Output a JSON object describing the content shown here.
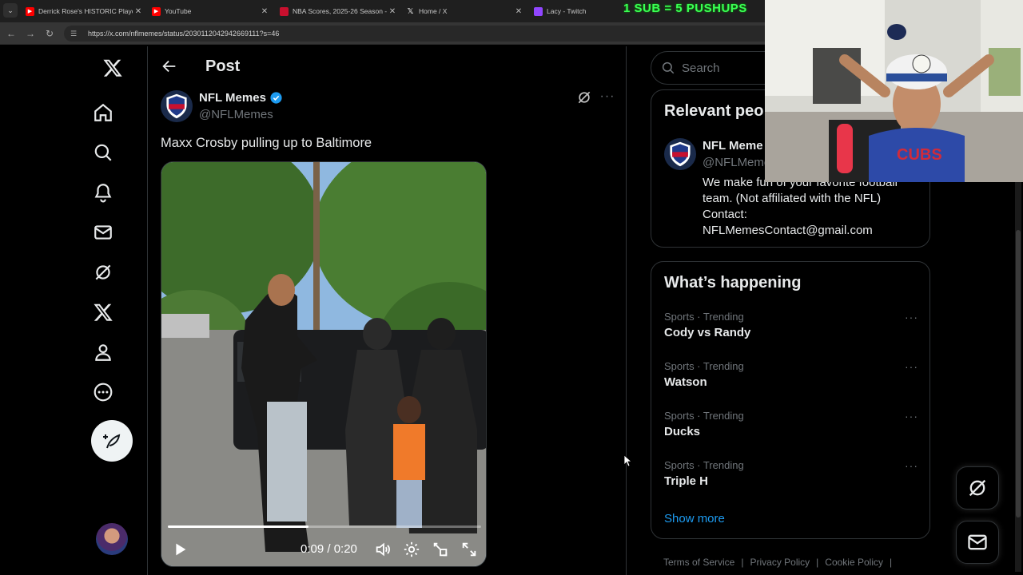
{
  "browser": {
    "tabs": [
      {
        "label": "Derrick Rose's HISTORIC Playoff",
        "favicon": "youtube-icon",
        "color": "#ff0000",
        "active": false
      },
      {
        "label": "YouTube",
        "favicon": "youtube-icon",
        "color": "#ff0000",
        "active": false
      },
      {
        "label": "NBA Scores, 2025-26 Season -",
        "favicon": "nba-icon",
        "color": "#c8102e",
        "active": false
      },
      {
        "label": "Home / X",
        "favicon": "x-icon",
        "color": "#000000",
        "active": false
      },
      {
        "label": "Lacy - Twitch",
        "favicon": "twitch-icon",
        "color": "#9146ff",
        "active": false
      }
    ],
    "overlay_banner": "1 SUB = 5 PUSHUPS",
    "url": "https://x.com/nflmemes/status/2030112042942669111?s=46"
  },
  "nav": {
    "items": [
      "x-logo-icon",
      "home-icon",
      "search-icon",
      "notifications-icon",
      "messages-icon",
      "grok-icon",
      "premium-x-icon",
      "profile-icon",
      "more-icon"
    ]
  },
  "post": {
    "header_title": "Post",
    "author_name": "NFL Memes",
    "author_handle": "@NFLMemes",
    "text": "Maxx Crosby pulling up to Baltimore",
    "video": {
      "current_time": "0:09",
      "duration": "0:20",
      "time_display": "0:09 / 0:20",
      "progress": 0.45
    }
  },
  "search": {
    "placeholder": "Search"
  },
  "relevant": {
    "title": "Relevant peo",
    "name": "NFL Meme",
    "handle": "@NFLMeme",
    "bio": "We make fun of your favorite football team. (Not affiliated with the NFL) Contact: NFLMemesContact@gmail.com"
  },
  "happening": {
    "title": "What’s happening",
    "trends": [
      {
        "meta": "Sports · Trending",
        "name": "Cody vs Randy"
      },
      {
        "meta": "Sports · Trending",
        "name": "Watson"
      },
      {
        "meta": "Sports · Trending",
        "name": "Ducks"
      },
      {
        "meta": "Sports · Trending",
        "name": "Triple H"
      }
    ],
    "show_more": "Show more"
  },
  "footer": {
    "links": [
      "Terms of Service",
      "Privacy Policy",
      "Cookie Policy"
    ]
  },
  "colors": {
    "accent": "#1d9bf0",
    "background": "#000000",
    "border": "#2f3336",
    "muted": "#71767b",
    "banner": "#3bff55"
  }
}
